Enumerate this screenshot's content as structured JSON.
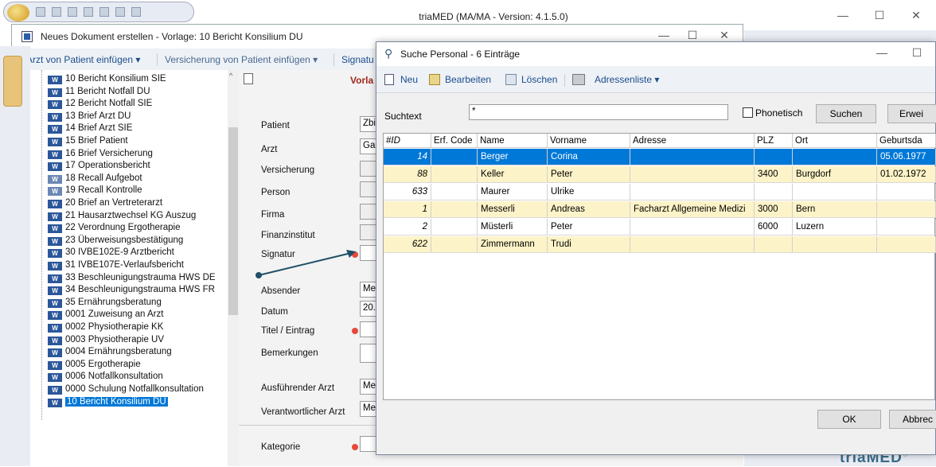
{
  "main": {
    "title": "triaMED (MA/MA - Version: 4.1.5.0)",
    "logo_text": "triaMED",
    "logo_mark": "®",
    "minimize": "—",
    "maximize": "☐",
    "close": "✕"
  },
  "doc_window": {
    "title": "Neues Dokument erstellen - Vorlage: 10 Bericht Konsilium DU",
    "minimize": "—",
    "maximize": "☐",
    "close": "✕",
    "toolbar": {
      "arzt": "Arzt von Patient einfügen ▾",
      "versicherung": "Versicherung von Patient einfügen ▾",
      "signatur": "Signatu"
    },
    "tree": [
      {
        "label": "10 Bericht Konsilium SIE"
      },
      {
        "label": "11 Bericht Notfall DU"
      },
      {
        "label": "12 Bericht Notfall SIE"
      },
      {
        "label": "13 Brief Arzt DU"
      },
      {
        "label": "14 Brief Arzt SIE"
      },
      {
        "label": "15 Brief Patient"
      },
      {
        "label": "16 Brief Versicherung"
      },
      {
        "label": "17 Operationsbericht"
      },
      {
        "label": "18 Recall Aufgebot"
      },
      {
        "label": "19 Recall Kontrolle"
      },
      {
        "label": "20 Brief an Vertreterarzt"
      },
      {
        "label": "21 Hausarztwechsel KG Auszug"
      },
      {
        "label": "22 Verordnung Ergotherapie"
      },
      {
        "label": "23 Überweisungsbestätigung"
      },
      {
        "label": "30 IVBE102E-9 Arztbericht"
      },
      {
        "label": "31 IVBE107E-Verlaufsbericht"
      },
      {
        "label": "33 Beschleunigungstrauma HWS DE"
      },
      {
        "label": "34 Beschleunigungstrauma HWS FR"
      },
      {
        "label": "35 Ernährungsberatung"
      },
      {
        "label": "0001 Zuweisung an Arzt"
      },
      {
        "label": "0002 Physiotherapie KK"
      },
      {
        "label": "0003 Physiotherapie UV"
      },
      {
        "label": "0004 Ernährungsberatung"
      },
      {
        "label": "0005 Ergotherapie"
      },
      {
        "label": "0006 Notfallkonsultation"
      },
      {
        "label": "0000 Schulung Notfallkonsultation"
      },
      {
        "label": "10 Bericht Konsilium DU"
      }
    ],
    "form": {
      "vorla": "Vorla",
      "patient_label": "Patient",
      "patient_value": "Zbi",
      "arzt_label": "Arzt",
      "arzt_value": "Ga",
      "versicherung_label": "Versicherung",
      "person_label": "Person",
      "firma_label": "Firma",
      "finanzinstitut_label": "Finanzinstitut",
      "signatur_label": "Signatur",
      "absender_label": "Absender",
      "absender_value": "Me",
      "datum_label": "Datum",
      "datum_value": "20.",
      "titel_label": "Titel / Eintrag",
      "bemerkungen_label": "Bemerkungen",
      "ausfuehrender_label": "Ausführender Arzt",
      "ausfuehrender_value": "Me",
      "verantwortlicher_label": "Verantwortlicher Arzt",
      "verantwortlicher_value": "Me",
      "kategorie_label": "Kategorie"
    }
  },
  "dialog": {
    "title": "Suche Personal - 6 Einträge",
    "minimize": "—",
    "maximize": "☐",
    "toolbar": {
      "neu": "Neu",
      "bearbeiten": "Bearbeiten",
      "loeschen": "Löschen",
      "adressenliste": "Adressenliste ▾"
    },
    "search": {
      "label": "Suchtext",
      "value": "*",
      "phonetisch": "Phonetisch",
      "suchen": "Suchen",
      "erweitert": "Erwei"
    },
    "columns": [
      "#ID",
      "Erf. Code",
      "Name",
      "Vorname",
      "Adresse",
      "PLZ",
      "Ort",
      "Geburtsda"
    ],
    "rows": [
      {
        "id": "14",
        "erf": "",
        "name": "Berger",
        "vorname": "Corina",
        "adresse": "",
        "plz": "",
        "ort": "",
        "geb": "05.06.1977"
      },
      {
        "id": "88",
        "erf": "",
        "name": "Keller",
        "vorname": "Peter",
        "adresse": "",
        "plz": "3400",
        "ort": "Burgdorf",
        "geb": "01.02.1972"
      },
      {
        "id": "633",
        "erf": "",
        "name": "Maurer",
        "vorname": "Ulrike",
        "adresse": "",
        "plz": "",
        "ort": "",
        "geb": ""
      },
      {
        "id": "1",
        "erf": "",
        "name": "Messerli",
        "vorname": "Andreas",
        "adresse": "Facharzt Allgemeine Medizi",
        "plz": "3000",
        "ort": "Bern",
        "geb": ""
      },
      {
        "id": "2",
        "erf": "",
        "name": "Müsterli",
        "vorname": "Peter",
        "adresse": "",
        "plz": "6000",
        "ort": "Luzern",
        "geb": ""
      },
      {
        "id": "622",
        "erf": "",
        "name": "Zimmermann",
        "vorname": "Trudi",
        "adresse": "",
        "plz": "",
        "ort": "",
        "geb": ""
      }
    ],
    "ok": "OK",
    "abbrechen": "Abbrec"
  },
  "colors": {
    "selected_row": "#0078d7",
    "highlight_row": "#fdf3c8",
    "link_blue": "#1a4d8c",
    "required_dot": "#e8483b",
    "annotation_arrow": "#1f4f66"
  }
}
